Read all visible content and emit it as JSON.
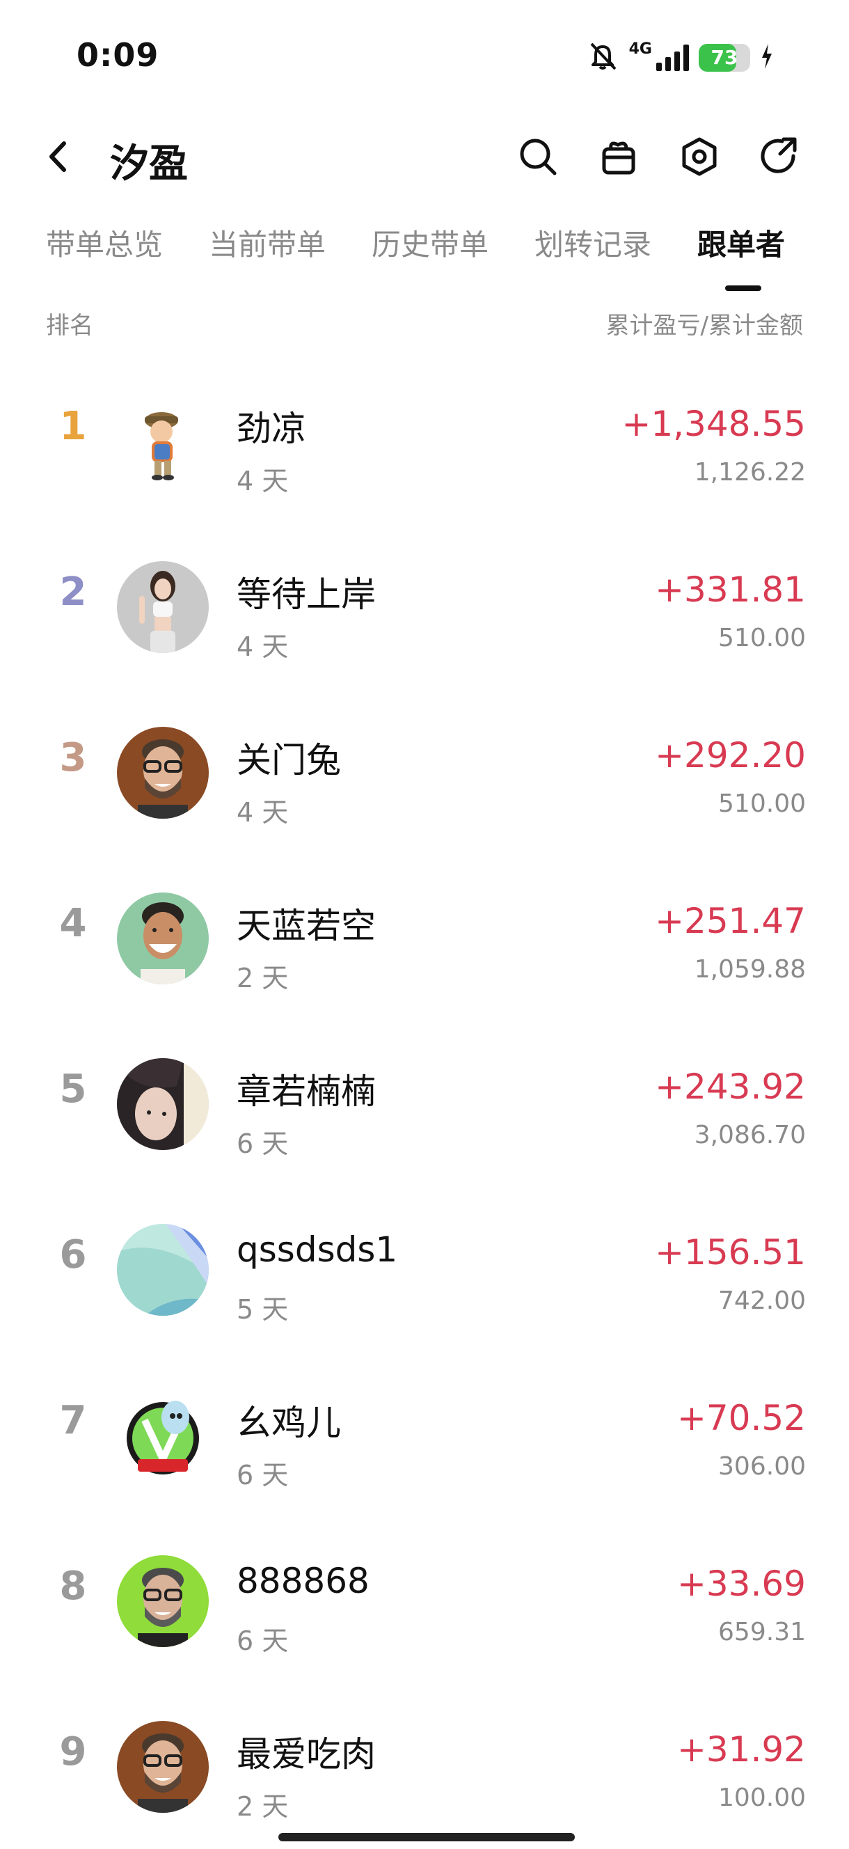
{
  "status": {
    "time": "0:09",
    "network": "4G",
    "battery": "73",
    "battery_level": 0.73
  },
  "header": {
    "title": "汐盈",
    "icons": [
      "back-icon",
      "search-icon",
      "gift-icon",
      "settings-icon",
      "share-icon"
    ]
  },
  "tabs": [
    {
      "label": "带单总览"
    },
    {
      "label": "当前带单"
    },
    {
      "label": "历史带单"
    },
    {
      "label": "划转记录"
    },
    {
      "label": "跟单者",
      "active": true
    }
  ],
  "columns": {
    "left": "排名",
    "right": "累计盈亏/累计金额"
  },
  "followers": [
    {
      "rank": "1",
      "name": "劲凉",
      "days": "4 天",
      "pnl": "+1,348.55",
      "amount": "1,126.22",
      "avatar": "cartoon-boy-avatar",
      "rank_color": "#e8a33c"
    },
    {
      "rank": "2",
      "name": "等待上岸",
      "days": "4 天",
      "pnl": "+331.81",
      "amount": "510.00",
      "avatar": "woman-photo-avatar",
      "rank_color": "#8e8fc6"
    },
    {
      "rank": "3",
      "name": "关门兔",
      "days": "4 天",
      "pnl": "+292.20",
      "amount": "510.00",
      "avatar": "bearded-man-avatar",
      "rank_color": "#c49a86"
    },
    {
      "rank": "4",
      "name": "天蓝若空",
      "days": "2 天",
      "pnl": "+251.47",
      "amount": "1,059.88",
      "avatar": "smiling-man-avatar",
      "rank_color": "#9a9a9a"
    },
    {
      "rank": "5",
      "name": "章若楠楠",
      "days": "6 天",
      "pnl": "+243.92",
      "amount": "3,086.70",
      "avatar": "girl-photo-avatar",
      "rank_color": "#9a9a9a"
    },
    {
      "rank": "6",
      "name": "qssdsds1",
      "days": "5 天",
      "pnl": "+156.51",
      "amount": "742.00",
      "avatar": "abstract-gradient-avatar",
      "rank_color": "#9a9a9a"
    },
    {
      "rank": "7",
      "name": "幺鸡儿",
      "days": "6 天",
      "pnl": "+70.52",
      "amount": "306.00",
      "avatar": "rick-cartoon-avatar",
      "rank_color": "#9a9a9a"
    },
    {
      "rank": "8",
      "name": "888868",
      "days": "6 天",
      "pnl": "+33.69",
      "amount": "659.31",
      "avatar": "bearded-man-green-avatar",
      "rank_color": "#9a9a9a"
    },
    {
      "rank": "9",
      "name": "最爱吃肉",
      "days": "2 天",
      "pnl": "+31.92",
      "amount": "100.00",
      "avatar": "bearded-man-avatar",
      "rank_color": "#9a9a9a"
    }
  ]
}
